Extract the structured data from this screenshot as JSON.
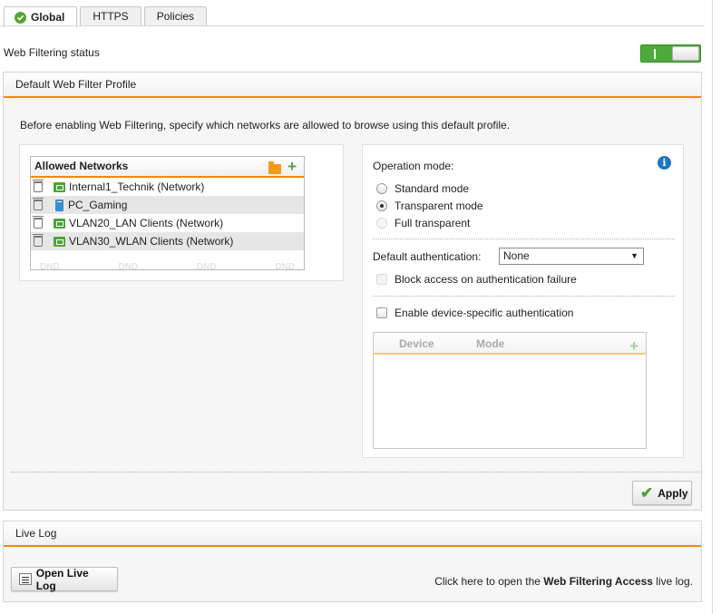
{
  "tabs": [
    {
      "label": "Global",
      "active": true
    },
    {
      "label": "HTTPS",
      "active": false
    },
    {
      "label": "Policies",
      "active": false
    }
  ],
  "status": {
    "label": "Web Filtering status",
    "enabled": true
  },
  "profile": {
    "title": "Default Web Filter Profile",
    "intro": "Before enabling Web Filtering, specify which networks are allowed to browse using this default profile.",
    "allowed_networks": {
      "title": "Allowed Networks",
      "items": [
        {
          "label": "Internal1_Technik (Network)",
          "type": "network"
        },
        {
          "label": "PC_Gaming",
          "type": "host"
        },
        {
          "label": "VLAN20_LAN Clients (Network)",
          "type": "network"
        },
        {
          "label": "VLAN30_WLAN Clients (Network)",
          "type": "network"
        }
      ],
      "dnd": [
        "DND",
        "DND",
        "DND",
        "DND"
      ]
    },
    "operation": {
      "label": "Operation mode:",
      "options": [
        "Standard mode",
        "Transparent mode",
        "Full transparent"
      ],
      "selected": "Transparent mode"
    },
    "authentication": {
      "label": "Default authentication:",
      "value": "None",
      "block_label": "Block access on authentication failure",
      "device_specific_label": "Enable device-specific authentication"
    },
    "device_table": {
      "columns": [
        "Device",
        "Mode"
      ]
    },
    "apply_label": "Apply"
  },
  "live_log": {
    "title": "Live Log",
    "button_label": "Open Live Log",
    "hint_prefix": "Click here to open the ",
    "hint_bold": "Web Filtering Access",
    "hint_suffix": " live log."
  },
  "colors": {
    "accent": "#ef8a0a",
    "green": "#4eaa3a",
    "info": "#1f74c5"
  }
}
